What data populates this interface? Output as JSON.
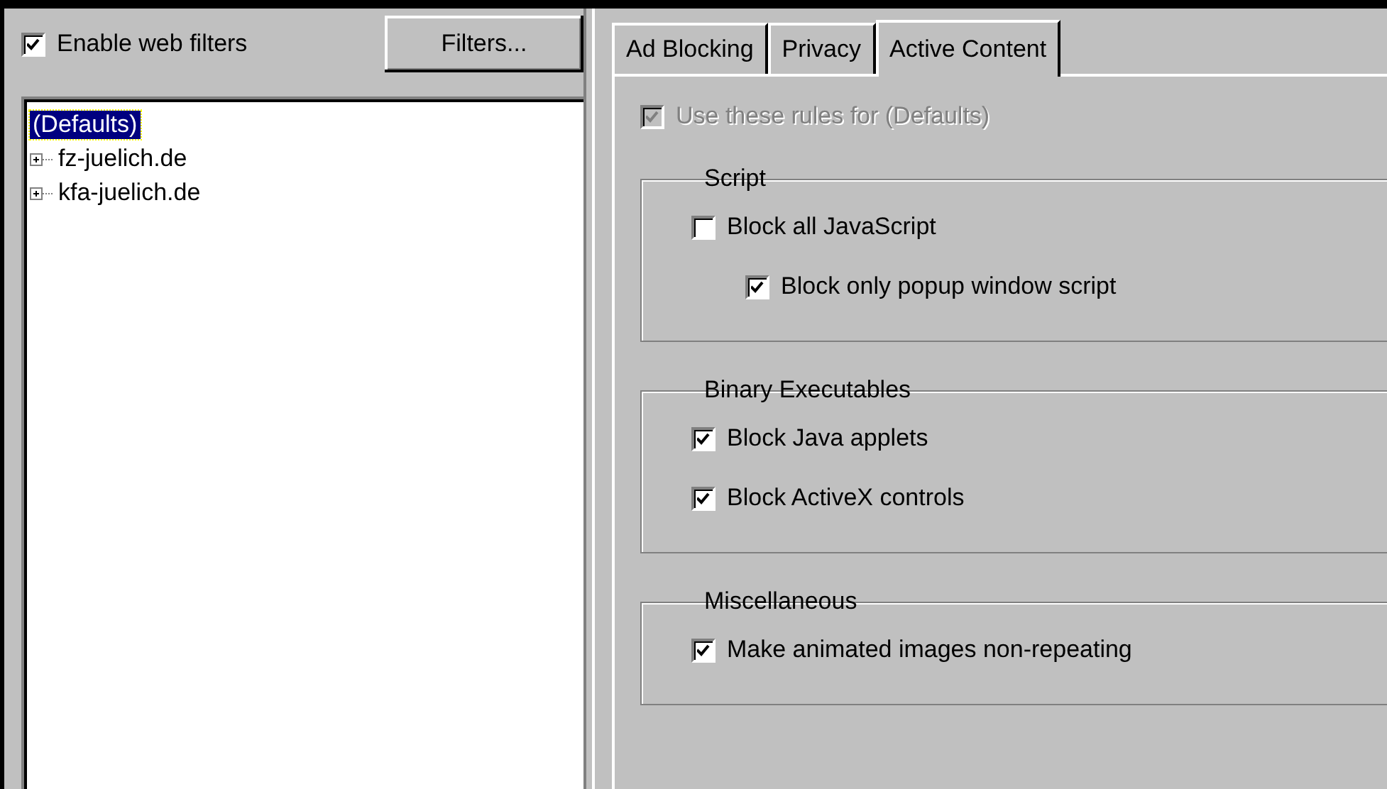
{
  "enable_filters": {
    "label": "Enable web filters",
    "checked": true
  },
  "filters_button": "Filters...",
  "tree": [
    {
      "label": "(Defaults)",
      "selected": true
    },
    {
      "label": "fz-juelich.de",
      "selected": false,
      "expanded": false
    },
    {
      "label": "kfa-juelich.de",
      "selected": false,
      "expanded": false
    }
  ],
  "tabs": [
    {
      "label": "Ad Blocking",
      "selected": false
    },
    {
      "label": "Privacy",
      "selected": false
    },
    {
      "label": "Active Content",
      "selected": true
    }
  ],
  "use_rules": {
    "label": "Use these rules for (Defaults)",
    "checked": true,
    "disabled": true
  },
  "groups": [
    {
      "title": "Script",
      "options": [
        {
          "label": "Block all JavaScript",
          "checked": false,
          "indented": false
        },
        {
          "label": "Block only popup window script",
          "checked": true,
          "indented": true
        }
      ]
    },
    {
      "title": "Binary Executables",
      "options": [
        {
          "label": "Block Java applets",
          "checked": true,
          "indented": false
        },
        {
          "label": "Block ActiveX controls",
          "checked": true,
          "indented": false
        }
      ]
    },
    {
      "title": "Miscellaneous",
      "options": [
        {
          "label": "Make animated images non-repeating",
          "checked": true,
          "indented": false
        }
      ]
    }
  ]
}
